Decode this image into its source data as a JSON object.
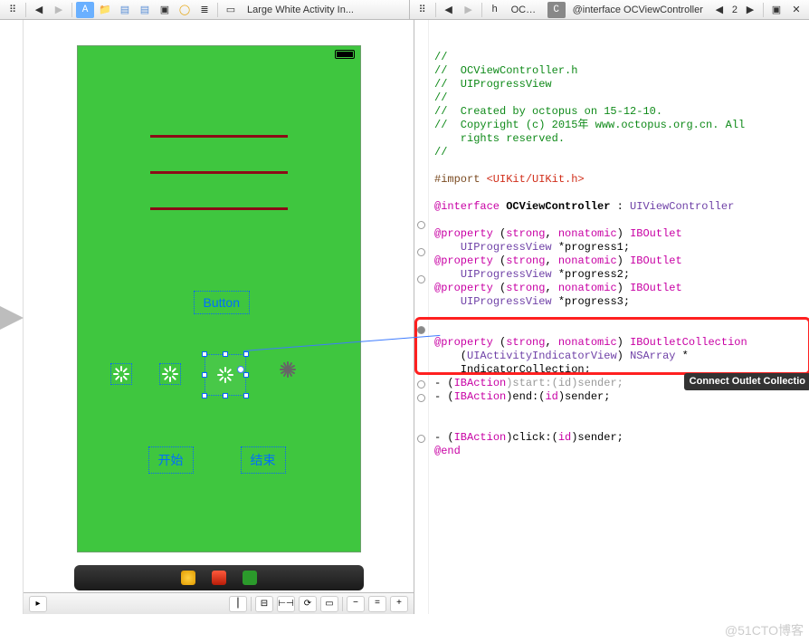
{
  "left_toolbar": {
    "tab": "Large White Activity In..."
  },
  "right_toolbar": {
    "tab1": "OCVi...",
    "tab2": "@interface OCViewController",
    "counter": "2"
  },
  "canvas": {
    "button_label": "Button",
    "start_label": "开始",
    "end_label": "结束"
  },
  "tooltip": "Connect Outlet Collectio",
  "watermark": "@51CTO博客",
  "code": {
    "c1": "//",
    "c2": "//  OCViewController.h",
    "c3": "//  UIProgressView",
    "c4": "//",
    "c5": "//  Created by octopus on 15-12-10.",
    "c6": "//  Copyright (c) 2015年 www.octopus.org.cn. All",
    "c6b": "    rights reserved.",
    "c7": "//",
    "imp1": "#import ",
    "imp2": "<UIKit/UIKit.h>",
    "if1a": "@interface ",
    "if1b": "OCViewController",
    "if1c": " : ",
    "if1d": "UIViewController",
    "p_a": "@property ",
    "p_b": "(",
    "p_s": "strong",
    "p_comma": ", ",
    "p_n": "nonatomic",
    "p_c": ") ",
    "p_ib": "IBOutlet",
    "pv": "UIProgressView",
    "star_p1": " *progress1;",
    "star_p2": " *progress2;",
    "star_p3": " *progress3;",
    "iboc": "IBOutletCollection",
    "aiv_open": "    (",
    "aiv": "UIActivityIndicatorView",
    "aiv_close": ") ",
    "nsarr": "NSArray",
    "star_ic": " *",
    "ic_name": "    IndicatorCollection;",
    "act_a": "- (",
    "act_ib": "IBAction",
    "act_start_hidden": ")start:(id)sender;",
    "act_end": ")end:(",
    "act_click": ")click:(",
    "id": "id",
    "sender": ")sender;",
    "end": "@end"
  }
}
